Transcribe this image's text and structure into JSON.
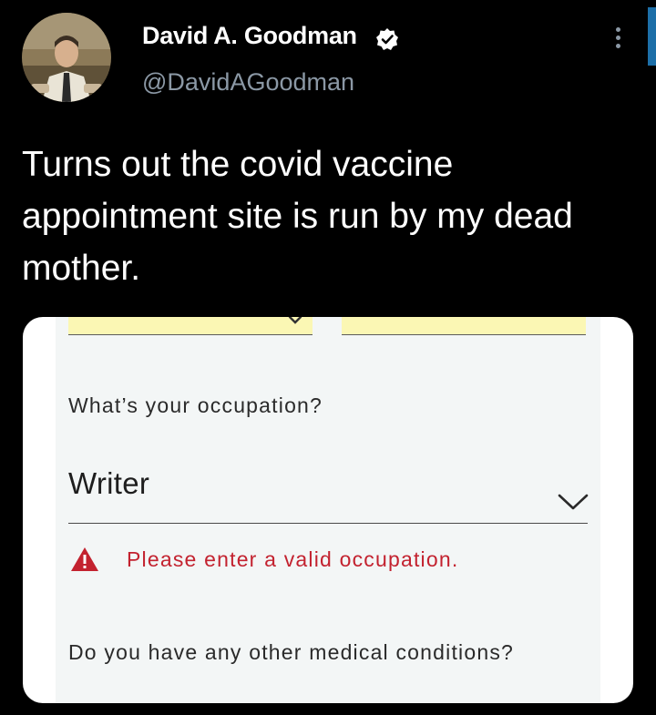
{
  "author": {
    "name": "David A. Goodman",
    "handle": "@DavidAGoodman",
    "verified_icon": "verified-badge-icon",
    "avatar": "profile-photo"
  },
  "tweet": {
    "text": "Turns out the covid vaccine appointment site is run by my dead mother."
  },
  "form": {
    "occupation_question": "What’s your occupation?",
    "occupation_value": "Writer",
    "error_message": "Please enter a valid occupation.",
    "medical_question": "Do you have any other medical conditions?"
  },
  "colors": {
    "background": "#000000",
    "handle": "#8b98a5",
    "error": "#c3222f",
    "highlight_field": "#fbf7b4",
    "form_panel": "#f3f6f6"
  }
}
